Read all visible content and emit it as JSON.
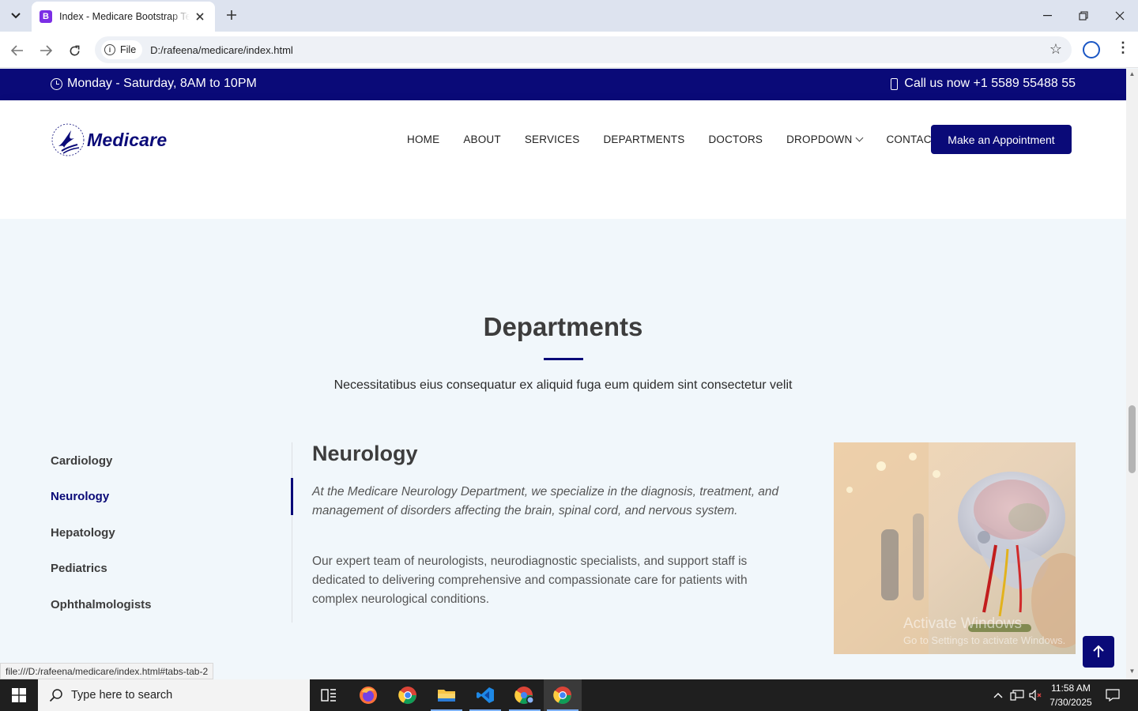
{
  "browser": {
    "tab_title": "Index - Medicare Bootstrap Template",
    "tab_favicon_letter": "B",
    "chip_label": "File",
    "url": "D:/rafeena/medicare/index.html",
    "status_url": "file:///D:/rafeena/medicare/index.html#tabs-tab-2"
  },
  "topbar": {
    "hours": "Monday - Saturday, 8AM to 10PM",
    "phone": "Call us now +1 5589 55488 55"
  },
  "header": {
    "logo_text": "Medicare",
    "nav": [
      "HOME",
      "ABOUT",
      "SERVICES",
      "DEPARTMENTS",
      "DOCTORS",
      "DROPDOWN",
      "CONTACT"
    ],
    "cta": "Make an Appointment"
  },
  "departments": {
    "title": "Departments",
    "subtitle": "Necessitatibus eius consequatur ex aliquid fuga eum quidem sint consectetur velit",
    "tabs": [
      "Cardiology",
      "Neurology",
      "Hepatology",
      "Pediatrics",
      "Ophthalmologists"
    ],
    "active_tab": "Neurology",
    "content": {
      "heading": "Neurology",
      "lead": "At the Medicare Neurology Department, we specialize in the diagnosis, treatment, and management of disorders affecting the brain, spinal cord, and nervous system.",
      "body": "Our expert team of neurologists, neurodiagnostic specialists, and support staff is dedicated to delivering comprehensive and compassionate care for patients with complex neurological conditions."
    }
  },
  "watermark": {
    "line1": "Activate Windows",
    "line2": "Go to Settings to activate Windows."
  },
  "taskbar": {
    "search_placeholder": "Type here to search",
    "time": "11:58 AM",
    "date": "7/30/2025"
  },
  "colors": {
    "brand": "#0a0a78",
    "section_bg": "#f1f7fb"
  }
}
